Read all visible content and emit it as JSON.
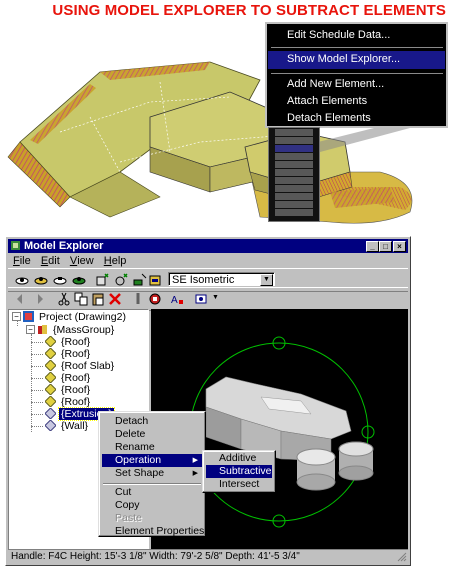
{
  "heading": "USING MODEL EXPLORER TO SUBTRACT ELEMENTS",
  "colors": {
    "heading": "#e8140c",
    "titlebar": "#000080",
    "menu_bg": "#000000",
    "menu_highlight": "#18188a",
    "viewport_bg": "#000000",
    "circle": "#00c000"
  },
  "context_menu_large": {
    "items": [
      "Edit Schedule Data...",
      "Show Model Explorer...",
      "Add New Element...",
      "Attach Elements",
      "Detach Elements"
    ],
    "selected": "Show Model Explorer..."
  },
  "window": {
    "title": "Model Explorer",
    "menus": [
      {
        "key": "F",
        "rest": "ile"
      },
      {
        "key": "E",
        "rest": "dit"
      },
      {
        "key": "V",
        "rest": "iew"
      },
      {
        "key": "H",
        "rest": "elp"
      }
    ],
    "view_select": "SE Isometric",
    "tree": {
      "project": "Project (Drawing2)",
      "group": "{MassGroup}",
      "children": [
        "{Roof}",
        "{Roof}",
        "{Roof Slab}",
        "{Roof}",
        "{Roof}",
        "{Roof}",
        "{Extrusion}",
        "{Wall}"
      ],
      "selected": "{Extrusion}"
    },
    "status_bar": "Handle: F4C  Height: 15'-3 1/8\"  Width: 79'-2 5/8\"  Depth: 41'-5 3/4\""
  },
  "context_menu": {
    "items": [
      "Detach",
      "Delete",
      "Rename",
      "Operation",
      "Set Shape",
      "Cut",
      "Copy",
      "Paste",
      "Element Properties..."
    ],
    "highlighted": "Operation",
    "disabled": "Paste"
  },
  "submenu": {
    "items": [
      "Additive",
      "Subtractive",
      "Intersect"
    ],
    "highlighted": "Subtractive"
  },
  "icons": [
    "app-icon",
    "minimize-icon",
    "maximize-icon",
    "close-icon",
    "orbit-icon",
    "pan-icon",
    "zoom-icon",
    "shade-icon",
    "move-icon",
    "rotate-icon",
    "add-icon",
    "cut-icon",
    "copy-icon",
    "paste-icon",
    "delete-icon",
    "clip-icon",
    "props-icon",
    "text-icon",
    "view-icon"
  ]
}
